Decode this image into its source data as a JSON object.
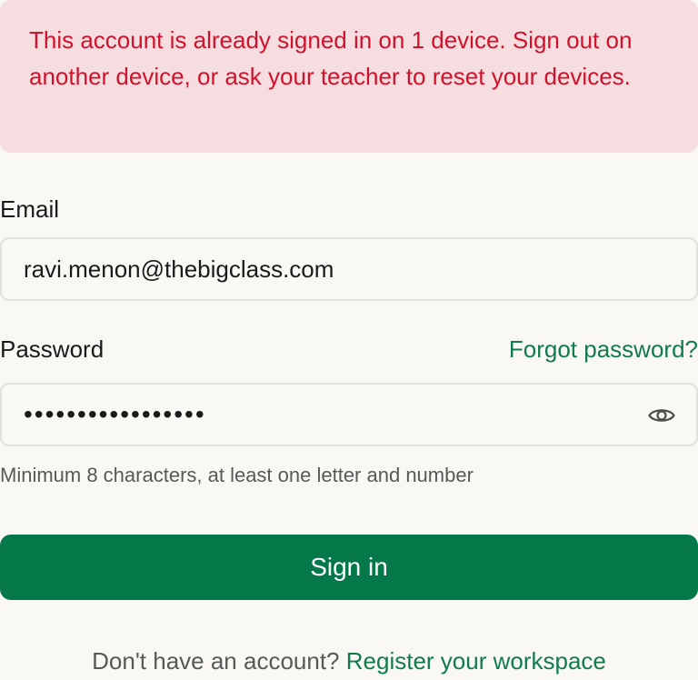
{
  "alert": {
    "message": "This account is already signed in on 1 device. Sign out on another device, or ask your teacher to reset your devices.",
    "color": "#d1122c",
    "background": "#f6dee0"
  },
  "email": {
    "label": "Email",
    "value": "ravi.menon@thebigclass.com"
  },
  "password": {
    "label": "Password",
    "value": "•••••••••••••••••",
    "forgot_link": "Forgot password?",
    "toggle_icon": "eye-icon",
    "hint": "Minimum 8 characters, at least one letter and number"
  },
  "signin": {
    "label": "Sign in",
    "color": "#05784a"
  },
  "footer": {
    "prompt": "Don't have an account?",
    "link": "Register your workspace",
    "link_color": "#117b4a"
  }
}
